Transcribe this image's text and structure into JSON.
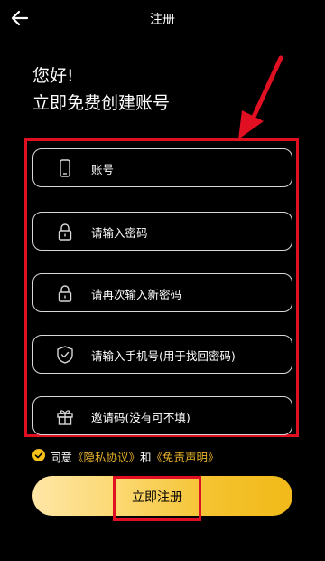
{
  "header": {
    "title": "注册",
    "back_icon": "arrow-left-icon"
  },
  "greeting": {
    "line1": "您好!",
    "line2": "立即免费创建账号"
  },
  "fields": [
    {
      "icon": "phone-icon",
      "text": "账号"
    },
    {
      "icon": "lock-icon",
      "text": "请输入密码"
    },
    {
      "icon": "lock-icon",
      "text": "请再次输入新密码"
    },
    {
      "icon": "shield-check-icon",
      "text": "请输入手机号(用于找回密码)"
    },
    {
      "icon": "gift-icon",
      "text": "邀请码(没有可不填)"
    }
  ],
  "agreement": {
    "prefix": "同意",
    "privacy": "《隐私协议》",
    "and": "和",
    "disclaimer": "《免责声明》"
  },
  "register_button": "立即注册",
  "colors": {
    "background": "#000000",
    "accent_yellow": "#f2ba19",
    "annotation_red": "#e10f22"
  }
}
